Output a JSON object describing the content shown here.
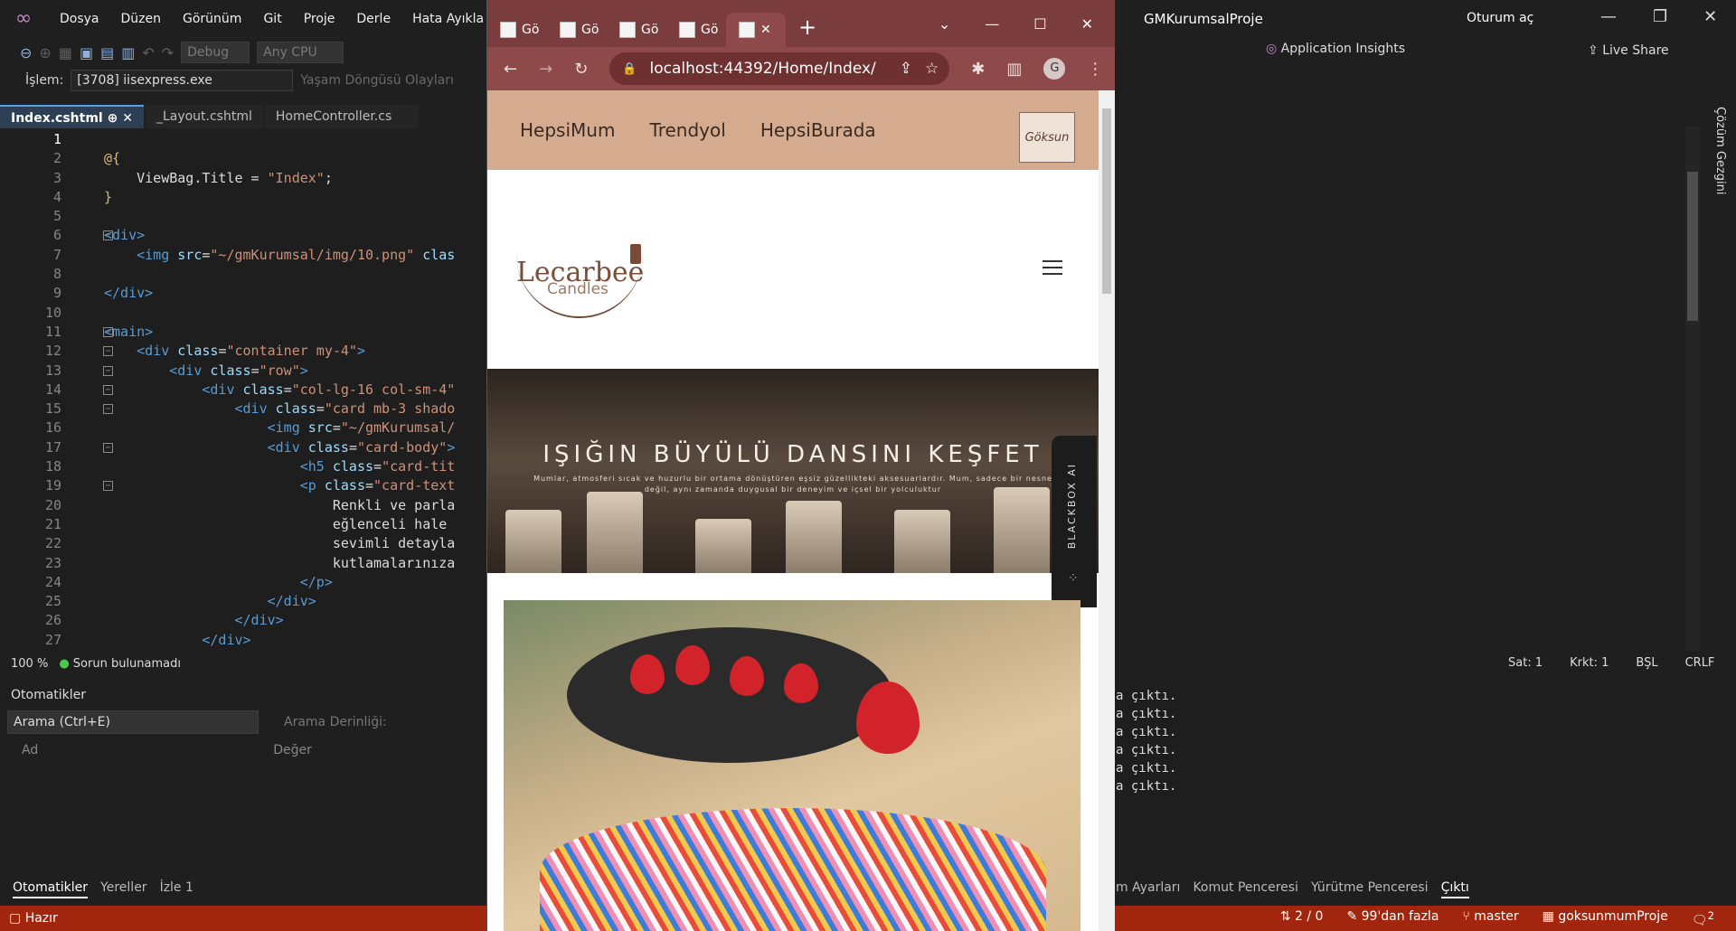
{
  "vs": {
    "menu": [
      "Dosya",
      "Düzen",
      "Görünüm",
      "Git",
      "Proje",
      "Derle",
      "Hata Ayıkla"
    ],
    "toolbar": {
      "config": "Debug",
      "platform": "Any CPU"
    },
    "process_label": "İşlem:",
    "process_value": "[3708] iisexpress.exe",
    "lifecycle": "Yaşam Döngüsü Olayları",
    "tabs": [
      "Index.cshtml",
      "_Layout.cshtml",
      "HomeController.cs"
    ],
    "zoom": "100 %",
    "no_issues": "Sorun bulunamadı",
    "autos": {
      "title": "Otomatikler",
      "search_placeholder": "Arama (Ctrl+E)",
      "depth": "Arama Derinliği:",
      "col_name": "Ad",
      "col_value": "Değer"
    },
    "bottom_tabs": [
      "Otomatikler",
      "Yereller",
      "İzle 1"
    ],
    "status": {
      "ready": "Hazır",
      "updown": "2 / 0",
      "changes": "99'dan fazla",
      "branch": "master",
      "repo": "goksunmumProje",
      "notif": "2"
    },
    "right": {
      "project_title": "GMKurumsalProje",
      "signin": "Oturum aç",
      "insights": "Application Insights",
      "liveshare": "Live Share",
      "side": "Çözüm Gezgini",
      "line": "Sat: 1",
      "col": "Krkt: 1",
      "mode": "BŞL",
      "eol": "CRLF"
    },
    "output_lines": [
      "a çıktı.",
      "a çıktı.",
      "a çıktı.",
      "a çıktı.",
      "a çıktı.",
      "a çıktı."
    ],
    "output_tabs": [
      "m Ayarları",
      "Komut Penceresi",
      "Yürütme Penceresi",
      "Çıktı"
    ]
  },
  "code_lines": [
    {
      "n": "1",
      "parts": []
    },
    {
      "n": "2",
      "parts": [
        {
          "c": "kw",
          "t": "@{"
        }
      ]
    },
    {
      "n": "3",
      "parts": [
        {
          "c": "txt",
          "t": "    ViewBag.Title = "
        },
        {
          "c": "str",
          "t": "\"Index\""
        },
        {
          "c": "txt",
          "t": ";"
        }
      ]
    },
    {
      "n": "4",
      "parts": [
        {
          "c": "kw",
          "t": "}"
        }
      ]
    },
    {
      "n": "5",
      "parts": []
    },
    {
      "n": "6",
      "parts": [
        {
          "c": "tag",
          "t": "<div>"
        }
      ]
    },
    {
      "n": "7",
      "parts": [
        {
          "c": "tag",
          "t": "    <img "
        },
        {
          "c": "attr",
          "t": "src"
        },
        {
          "c": "txt",
          "t": "="
        },
        {
          "c": "str",
          "t": "\"~/gmKurumsal/img/10.png\""
        },
        {
          "c": "attr",
          "t": " clas"
        }
      ]
    },
    {
      "n": "8",
      "parts": []
    },
    {
      "n": "9",
      "parts": [
        {
          "c": "tag",
          "t": "</div>"
        }
      ]
    },
    {
      "n": "10",
      "parts": []
    },
    {
      "n": "11",
      "parts": [
        {
          "c": "tag",
          "t": "<main>"
        }
      ]
    },
    {
      "n": "12",
      "parts": [
        {
          "c": "tag",
          "t": "    <div "
        },
        {
          "c": "attr",
          "t": "class"
        },
        {
          "c": "txt",
          "t": "="
        },
        {
          "c": "str",
          "t": "\"container my-4\""
        },
        {
          "c": "tag",
          "t": ">"
        }
      ]
    },
    {
      "n": "13",
      "parts": [
        {
          "c": "tag",
          "t": "        <div "
        },
        {
          "c": "attr",
          "t": "class"
        },
        {
          "c": "txt",
          "t": "="
        },
        {
          "c": "str",
          "t": "\"row\""
        },
        {
          "c": "tag",
          "t": ">"
        }
      ]
    },
    {
      "n": "14",
      "parts": [
        {
          "c": "tag",
          "t": "            <div "
        },
        {
          "c": "attr",
          "t": "class"
        },
        {
          "c": "txt",
          "t": "="
        },
        {
          "c": "str",
          "t": "\"col-lg-16 col-sm-4\""
        }
      ]
    },
    {
      "n": "15",
      "parts": [
        {
          "c": "tag",
          "t": "                <div "
        },
        {
          "c": "attr",
          "t": "class"
        },
        {
          "c": "txt",
          "t": "="
        },
        {
          "c": "str",
          "t": "\"card mb-3 shado"
        }
      ]
    },
    {
      "n": "16",
      "parts": [
        {
          "c": "tag",
          "t": "                    <img "
        },
        {
          "c": "attr",
          "t": "src"
        },
        {
          "c": "txt",
          "t": "="
        },
        {
          "c": "str",
          "t": "\"~/gmKurumsal/"
        }
      ]
    },
    {
      "n": "17",
      "parts": [
        {
          "c": "tag",
          "t": "                    <div "
        },
        {
          "c": "attr",
          "t": "class"
        },
        {
          "c": "txt",
          "t": "="
        },
        {
          "c": "str",
          "t": "\"card-body\""
        },
        {
          "c": "tag",
          "t": ">"
        }
      ]
    },
    {
      "n": "18",
      "parts": [
        {
          "c": "tag",
          "t": "                        <h5 "
        },
        {
          "c": "attr",
          "t": "class"
        },
        {
          "c": "txt",
          "t": "="
        },
        {
          "c": "str",
          "t": "\"card-tit"
        }
      ]
    },
    {
      "n": "19",
      "parts": [
        {
          "c": "tag",
          "t": "                        <p "
        },
        {
          "c": "attr",
          "t": "class"
        },
        {
          "c": "txt",
          "t": "="
        },
        {
          "c": "str",
          "t": "\"card-text"
        }
      ]
    },
    {
      "n": "20",
      "parts": [
        {
          "c": "txt",
          "t": "                            Renkli ve parla"
        }
      ]
    },
    {
      "n": "21",
      "parts": [
        {
          "c": "txt",
          "t": "                            eğlenceli hale"
        }
      ]
    },
    {
      "n": "22",
      "parts": [
        {
          "c": "txt",
          "t": "                            sevimli detayla"
        }
      ]
    },
    {
      "n": "23",
      "parts": [
        {
          "c": "txt",
          "t": "                            kutlamalarınıza"
        }
      ]
    },
    {
      "n": "24",
      "parts": [
        {
          "c": "tag",
          "t": "                        </p>"
        }
      ]
    },
    {
      "n": "25",
      "parts": [
        {
          "c": "tag",
          "t": "                    </div>"
        }
      ]
    },
    {
      "n": "26",
      "parts": [
        {
          "c": "tag",
          "t": "                </div>"
        }
      ]
    },
    {
      "n": "27",
      "parts": [
        {
          "c": "tag",
          "t": "            </div>"
        }
      ]
    }
  ],
  "chrome": {
    "tab_label": "Gö",
    "url": "localhost:44392/Home/Index/",
    "profile": "G"
  },
  "site": {
    "nav": [
      "HepsiMum",
      "Trendyol",
      "HepsiBurada"
    ],
    "nav_logo": "Göksun",
    "brand": "Lecarbee",
    "brand_sub": "Candles",
    "hero_title": "IŞIĞIN BÜYÜLÜ DANSINI KEŞFET",
    "hero_text": "Mumlar, atmosferi sıcak ve huzurlu bir ortama dönüştüren eşsiz güzellikteki aksesuarlardır. Mum, sadece bir nesne değil, aynı zamanda duygusal bir deneyim ve içsel bir yolculuktur",
    "blackbox": "BLACKBOX AI"
  }
}
